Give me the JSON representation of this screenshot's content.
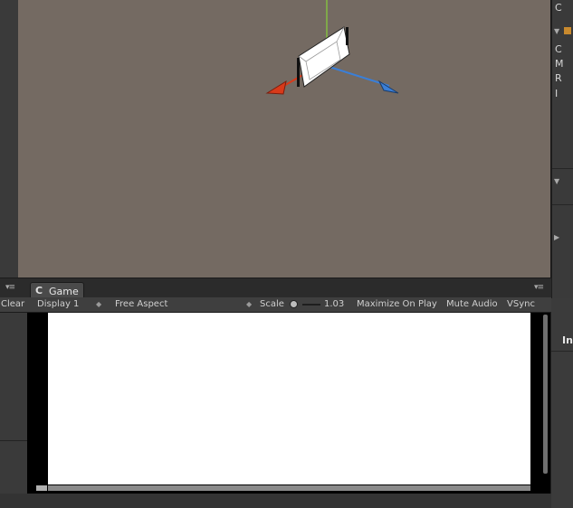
{
  "game_tab": {
    "icon": "pacman-icon",
    "label": "Game"
  },
  "toolbar": {
    "clear_label": "Clear",
    "display": "Display 1",
    "aspect": "Free Aspect",
    "scale_label": "Scale",
    "scale_value": "1.03",
    "maximize_on_play": "Maximize On Play",
    "mute_audio": "Mute Audio",
    "vsync": "VSync"
  },
  "inspector": {
    "row_letters": [
      "C",
      "C",
      "M",
      "R",
      "I"
    ],
    "lower_label": "In",
    "accent_color": "#c98a2e"
  },
  "scene": {
    "background_color": "#746a62",
    "gizmo_colors": {
      "x": "#d83a1a",
      "y": "#7fa84a",
      "z": "#3a7fd8"
    }
  },
  "game_view": {
    "background_color": "#ffffff"
  }
}
